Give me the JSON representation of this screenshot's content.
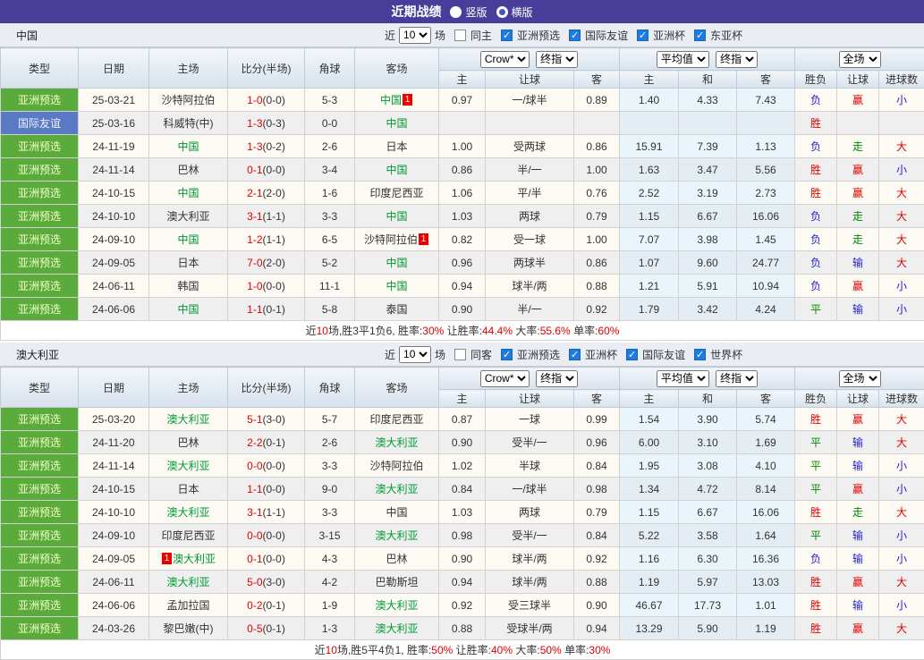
{
  "title_bar": {
    "title": "近期战绩",
    "options": [
      {
        "label": "竖版",
        "selected": false
      },
      {
        "label": "横版",
        "selected": true
      }
    ]
  },
  "header": {
    "static_cols": [
      "类型",
      "日期",
      "主场",
      "比分(半场)",
      "角球",
      "客场"
    ],
    "group1": {
      "selects": [
        "Crow*",
        "终指"
      ],
      "cols": [
        "主",
        "让球",
        "客"
      ]
    },
    "group2": {
      "selects": [
        "平均值",
        "终指"
      ],
      "cols": [
        "主",
        "和",
        "客"
      ]
    },
    "group3": {
      "selects": [
        "全场"
      ],
      "cols": [
        "胜负",
        "让球",
        "进球数"
      ]
    }
  },
  "result_colors": {
    "胜": "red",
    "平": "green",
    "负": "blue",
    "赢": "red",
    "走": "green",
    "输": "blue",
    "大": "red",
    "小": "blue"
  },
  "sections": [
    {
      "team": "中国",
      "filter": {
        "near": "近",
        "games": "10",
        "games_suffix": "场",
        "same": "同主",
        "same_checked": false,
        "leagues": [
          "亚洲预选",
          "国际友谊",
          "亚洲杯",
          "东亚杯"
        ]
      },
      "rows": [
        {
          "type": "亚洲预选",
          "tc": "green",
          "date": "25-03-21",
          "home": "沙特阿拉伯",
          "hf": false,
          "score": "1-0",
          "half": "(0-0)",
          "corner": "5-3",
          "away": "中国",
          "af": true,
          "ab": "1",
          "o1": "0.97",
          "hcp": "一/球半",
          "o2": "0.89",
          "a1": "1.40",
          "a2": "4.33",
          "a3": "7.43",
          "r1": "负",
          "r2": "赢",
          "r3": "小"
        },
        {
          "type": "国际友谊",
          "tc": "blue",
          "date": "25-03-16",
          "home": "科威特(中)",
          "hf": false,
          "score": "1-3",
          "half": "(0-3)",
          "corner": "0-0",
          "away": "中国",
          "af": true,
          "o1": "",
          "hcp": "",
          "o2": "",
          "a1": "",
          "a2": "",
          "a3": "",
          "r1": "胜",
          "r2": "",
          "r3": ""
        },
        {
          "type": "亚洲预选",
          "tc": "green",
          "date": "24-11-19",
          "home": "中国",
          "hf": true,
          "score": "1-3",
          "half": "(0-2)",
          "corner": "2-6",
          "away": "日本",
          "af": false,
          "o1": "1.00",
          "hcp": "受两球",
          "o2": "0.86",
          "a1": "15.91",
          "a2": "7.39",
          "a3": "1.13",
          "r1": "负",
          "r2": "走",
          "r3": "大"
        },
        {
          "type": "亚洲预选",
          "tc": "green",
          "date": "24-11-14",
          "home": "巴林",
          "hf": false,
          "score": "0-1",
          "half": "(0-0)",
          "corner": "3-4",
          "away": "中国",
          "af": true,
          "o1": "0.86",
          "hcp": "半/一",
          "o2": "1.00",
          "a1": "1.63",
          "a2": "3.47",
          "a3": "5.56",
          "r1": "胜",
          "r2": "赢",
          "r3": "小"
        },
        {
          "type": "亚洲预选",
          "tc": "green",
          "date": "24-10-15",
          "home": "中国",
          "hf": true,
          "score": "2-1",
          "half": "(2-0)",
          "corner": "1-6",
          "away": "印度尼西亚",
          "af": false,
          "o1": "1.06",
          "hcp": "平/半",
          "o2": "0.76",
          "a1": "2.52",
          "a2": "3.19",
          "a3": "2.73",
          "r1": "胜",
          "r2": "赢",
          "r3": "大"
        },
        {
          "type": "亚洲预选",
          "tc": "green",
          "date": "24-10-10",
          "home": "澳大利亚",
          "hf": false,
          "score": "3-1",
          "half": "(1-1)",
          "corner": "3-3",
          "away": "中国",
          "af": true,
          "o1": "1.03",
          "hcp": "两球",
          "o2": "0.79",
          "a1": "1.15",
          "a2": "6.67",
          "a3": "16.06",
          "r1": "负",
          "r2": "走",
          "r3": "大"
        },
        {
          "type": "亚洲预选",
          "tc": "green",
          "date": "24-09-10",
          "home": "中国",
          "hf": true,
          "score": "1-2",
          "half": "(1-1)",
          "corner": "6-5",
          "away": "沙特阿拉伯",
          "af": false,
          "ab": "1",
          "o1": "0.82",
          "hcp": "受一球",
          "o2": "1.00",
          "a1": "7.07",
          "a2": "3.98",
          "a3": "1.45",
          "r1": "负",
          "r2": "走",
          "r3": "大"
        },
        {
          "type": "亚洲预选",
          "tc": "green",
          "date": "24-09-05",
          "home": "日本",
          "hf": false,
          "score": "7-0",
          "half": "(2-0)",
          "corner": "5-2",
          "away": "中国",
          "af": true,
          "o1": "0.96",
          "hcp": "两球半",
          "o2": "0.86",
          "a1": "1.07",
          "a2": "9.60",
          "a3": "24.77",
          "r1": "负",
          "r2": "输",
          "r3": "大"
        },
        {
          "type": "亚洲预选",
          "tc": "green",
          "date": "24-06-11",
          "home": "韩国",
          "hf": false,
          "score": "1-0",
          "half": "(0-0)",
          "corner": "11-1",
          "away": "中国",
          "af": true,
          "o1": "0.94",
          "hcp": "球半/两",
          "o2": "0.88",
          "a1": "1.21",
          "a2": "5.91",
          "a3": "10.94",
          "r1": "负",
          "r2": "赢",
          "r3": "小"
        },
        {
          "type": "亚洲预选",
          "tc": "green",
          "date": "24-06-06",
          "home": "中国",
          "hf": true,
          "score": "1-1",
          "half": "(0-1)",
          "corner": "5-8",
          "away": "泰国",
          "af": false,
          "o1": "0.90",
          "hcp": "半/一",
          "o2": "0.92",
          "a1": "1.79",
          "a2": "3.42",
          "a3": "4.24",
          "r1": "平",
          "r2": "输",
          "r3": "小"
        }
      ],
      "summary": [
        [
          "近",
          false
        ],
        [
          "10",
          true
        ],
        [
          "场,胜3平1负6, 胜率:",
          false
        ],
        [
          "30%",
          true
        ],
        [
          " 让胜率:",
          false
        ],
        [
          "44.4%",
          true
        ],
        [
          " 大率:",
          false
        ],
        [
          "55.6%",
          true
        ],
        [
          " 单率:",
          false
        ],
        [
          "60%",
          true
        ]
      ]
    },
    {
      "team": "澳大利亚",
      "filter": {
        "near": "近",
        "games": "10",
        "games_suffix": "场",
        "same": "同客",
        "same_checked": false,
        "leagues": [
          "亚洲预选",
          "亚洲杯",
          "国际友谊",
          "世界杯"
        ]
      },
      "rows": [
        {
          "type": "亚洲预选",
          "tc": "green",
          "date": "25-03-20",
          "home": "澳大利亚",
          "hf": true,
          "score": "5-1",
          "half": "(3-0)",
          "corner": "5-7",
          "away": "印度尼西亚",
          "af": false,
          "o1": "0.87",
          "hcp": "一球",
          "o2": "0.99",
          "a1": "1.54",
          "a2": "3.90",
          "a3": "5.74",
          "r1": "胜",
          "r2": "赢",
          "r3": "大"
        },
        {
          "type": "亚洲预选",
          "tc": "green",
          "date": "24-11-20",
          "home": "巴林",
          "hf": false,
          "score": "2-2",
          "half": "(0-1)",
          "corner": "2-6",
          "away": "澳大利亚",
          "af": true,
          "o1": "0.90",
          "hcp": "受半/一",
          "o2": "0.96",
          "a1": "6.00",
          "a2": "3.10",
          "a3": "1.69",
          "r1": "平",
          "r2": "输",
          "r3": "大"
        },
        {
          "type": "亚洲预选",
          "tc": "green",
          "date": "24-11-14",
          "home": "澳大利亚",
          "hf": true,
          "score": "0-0",
          "half": "(0-0)",
          "corner": "3-3",
          "away": "沙特阿拉伯",
          "af": false,
          "o1": "1.02",
          "hcp": "半球",
          "o2": "0.84",
          "a1": "1.95",
          "a2": "3.08",
          "a3": "4.10",
          "r1": "平",
          "r2": "输",
          "r3": "小"
        },
        {
          "type": "亚洲预选",
          "tc": "green",
          "date": "24-10-15",
          "home": "日本",
          "hf": false,
          "score": "1-1",
          "half": "(0-0)",
          "corner": "9-0",
          "away": "澳大利亚",
          "af": true,
          "o1": "0.84",
          "hcp": "一/球半",
          "o2": "0.98",
          "a1": "1.34",
          "a2": "4.72",
          "a3": "8.14",
          "r1": "平",
          "r2": "赢",
          "r3": "小"
        },
        {
          "type": "亚洲预选",
          "tc": "green",
          "date": "24-10-10",
          "home": "澳大利亚",
          "hf": true,
          "score": "3-1",
          "half": "(1-1)",
          "corner": "3-3",
          "away": "中国",
          "af": false,
          "o1": "1.03",
          "hcp": "两球",
          "o2": "0.79",
          "a1": "1.15",
          "a2": "6.67",
          "a3": "16.06",
          "r1": "胜",
          "r2": "走",
          "r3": "大"
        },
        {
          "type": "亚洲预选",
          "tc": "green",
          "date": "24-09-10",
          "home": "印度尼西亚",
          "hf": false,
          "score": "0-0",
          "half": "(0-0)",
          "corner": "3-15",
          "away": "澳大利亚",
          "af": true,
          "o1": "0.98",
          "hcp": "受半/一",
          "o2": "0.84",
          "a1": "5.22",
          "a2": "3.58",
          "a3": "1.64",
          "r1": "平",
          "r2": "输",
          "r3": "小"
        },
        {
          "type": "亚洲预选",
          "tc": "green",
          "date": "24-09-05",
          "home": "澳大利亚",
          "hf": true,
          "hb": "1",
          "hbp": "before",
          "score": "0-1",
          "half": "(0-0)",
          "corner": "4-3",
          "away": "巴林",
          "af": false,
          "o1": "0.90",
          "hcp": "球半/两",
          "o2": "0.92",
          "a1": "1.16",
          "a2": "6.30",
          "a3": "16.36",
          "r1": "负",
          "r2": "输",
          "r3": "小"
        },
        {
          "type": "亚洲预选",
          "tc": "green",
          "date": "24-06-11",
          "home": "澳大利亚",
          "hf": true,
          "score": "5-0",
          "half": "(3-0)",
          "corner": "4-2",
          "away": "巴勒斯坦",
          "af": false,
          "o1": "0.94",
          "hcp": "球半/两",
          "o2": "0.88",
          "a1": "1.19",
          "a2": "5.97",
          "a3": "13.03",
          "r1": "胜",
          "r2": "赢",
          "r3": "大"
        },
        {
          "type": "亚洲预选",
          "tc": "green",
          "date": "24-06-06",
          "home": "孟加拉国",
          "hf": false,
          "score": "0-2",
          "half": "(0-1)",
          "corner": "1-9",
          "away": "澳大利亚",
          "af": true,
          "o1": "0.92",
          "hcp": "受三球半",
          "o2": "0.90",
          "a1": "46.67",
          "a2": "17.73",
          "a3": "1.01",
          "r1": "胜",
          "r2": "输",
          "r3": "小"
        },
        {
          "type": "亚洲预选",
          "tc": "green",
          "date": "24-03-26",
          "home": "黎巴嫩(中)",
          "hf": false,
          "score": "0-5",
          "half": "(0-1)",
          "corner": "1-3",
          "away": "澳大利亚",
          "af": true,
          "o1": "0.88",
          "hcp": "受球半/两",
          "o2": "0.94",
          "a1": "13.29",
          "a2": "5.90",
          "a3": "1.19",
          "r1": "胜",
          "r2": "赢",
          "r3": "大"
        }
      ],
      "summary": [
        [
          "近",
          false
        ],
        [
          "10",
          true
        ],
        [
          "场,胜5平4负1, 胜率:",
          false
        ],
        [
          "50%",
          true
        ],
        [
          " 让胜率:",
          false
        ],
        [
          "40%",
          true
        ],
        [
          " 大率:",
          false
        ],
        [
          "50%",
          true
        ],
        [
          " 单率:",
          false
        ],
        [
          "30%",
          true
        ]
      ]
    }
  ]
}
